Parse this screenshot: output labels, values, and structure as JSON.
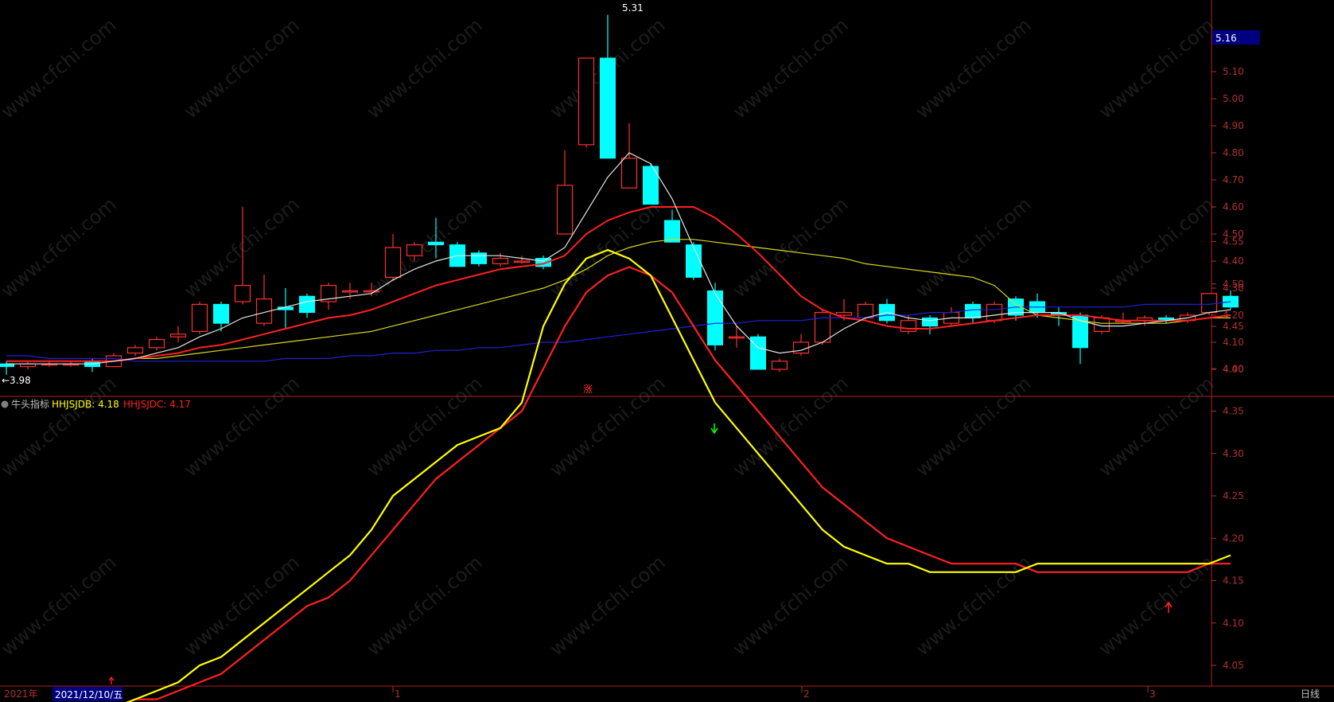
{
  "price_axis": {
    "ticks": [
      "5.10",
      "5.00",
      "4.90",
      "4.80",
      "4.70",
      "4.60",
      "4.50",
      "4.40",
      "4.30",
      "4.20",
      "4.10",
      "4.00"
    ],
    "current_price": "5.16"
  },
  "indicator_axis": {
    "ticks": [
      "4.55",
      "4.50",
      "4.45",
      "4.40",
      "4.35",
      "4.30",
      "4.25",
      "4.20",
      "4.15",
      "4.10",
      "4.05"
    ]
  },
  "annotations": {
    "high_label": "5.31",
    "low_label": "←3.98",
    "zhang": "涨"
  },
  "indicator_header": {
    "name": "牛头指标",
    "series_b_label": "HHJSJDB: 4.18",
    "series_c_label": "HHJSJDC: 4.17"
  },
  "time_axis": {
    "year_label": "2021年",
    "date_label": "2021/12/10/五",
    "month_labels": [
      "1",
      "2",
      "3"
    ],
    "period": "日线"
  },
  "watermark": "www.cfchi.com",
  "colors": {
    "up": "#ff3030",
    "down": "#00ffff",
    "ma_white": "#e6e6e6",
    "ma_red": "#ff2020",
    "ma_yellow": "#d8d820",
    "ma_blue": "#2020d8",
    "ind_yellow": "#ffff00",
    "ind_red": "#ff2020",
    "axis_red": "#b03030",
    "divider": "#b02020",
    "price_tag_bg": "#000080"
  },
  "chart_data": [
    {
      "type": "candlestick",
      "title": "",
      "ylim": [
        3.98,
        5.22
      ],
      "candles": [
        {
          "o": 4.02,
          "h": 4.03,
          "l": 3.98,
          "c": 4.01
        },
        {
          "o": 4.01,
          "h": 4.03,
          "l": 4.0,
          "c": 4.02
        },
        {
          "o": 4.02,
          "h": 4.03,
          "l": 4.01,
          "c": 4.02
        },
        {
          "o": 4.02,
          "h": 4.03,
          "l": 4.01,
          "c": 4.02
        },
        {
          "o": 4.03,
          "h": 4.04,
          "l": 3.99,
          "c": 4.01
        },
        {
          "o": 4.01,
          "h": 4.06,
          "l": 4.01,
          "c": 4.05
        },
        {
          "o": 4.06,
          "h": 4.09,
          "l": 4.05,
          "c": 4.08
        },
        {
          "o": 4.08,
          "h": 4.12,
          "l": 4.07,
          "c": 4.11
        },
        {
          "o": 4.12,
          "h": 4.16,
          "l": 4.1,
          "c": 4.13
        },
        {
          "o": 4.14,
          "h": 4.25,
          "l": 4.13,
          "c": 4.24
        },
        {
          "o": 4.24,
          "h": 4.25,
          "l": 4.14,
          "c": 4.17
        },
        {
          "o": 4.25,
          "h": 4.6,
          "l": 4.24,
          "c": 4.31
        },
        {
          "o": 4.17,
          "h": 4.35,
          "l": 4.16,
          "c": 4.26
        },
        {
          "o": 4.23,
          "h": 4.3,
          "l": 4.15,
          "c": 4.22
        },
        {
          "o": 4.27,
          "h": 4.28,
          "l": 4.19,
          "c": 4.21
        },
        {
          "o": 4.25,
          "h": 4.32,
          "l": 4.22,
          "c": 4.31
        },
        {
          "o": 4.29,
          "h": 4.32,
          "l": 4.26,
          "c": 4.29
        },
        {
          "o": 4.29,
          "h": 4.32,
          "l": 4.27,
          "c": 4.29
        },
        {
          "o": 4.34,
          "h": 4.5,
          "l": 4.33,
          "c": 4.45
        },
        {
          "o": 4.42,
          "h": 4.47,
          "l": 4.4,
          "c": 4.46
        },
        {
          "o": 4.47,
          "h": 4.56,
          "l": 4.41,
          "c": 4.46
        },
        {
          "o": 4.46,
          "h": 4.47,
          "l": 4.38,
          "c": 4.38
        },
        {
          "o": 4.43,
          "h": 4.44,
          "l": 4.38,
          "c": 4.39
        },
        {
          "o": 4.39,
          "h": 4.43,
          "l": 4.38,
          "c": 4.41
        },
        {
          "o": 4.4,
          "h": 4.42,
          "l": 4.39,
          "c": 4.4
        },
        {
          "o": 4.41,
          "h": 4.42,
          "l": 4.37,
          "c": 4.38
        },
        {
          "o": 4.5,
          "h": 4.81,
          "l": 4.5,
          "c": 4.68
        },
        {
          "o": 4.83,
          "h": 5.15,
          "l": 4.82,
          "c": 5.15
        },
        {
          "o": 5.15,
          "h": 5.31,
          "l": 4.78,
          "c": 4.78
        },
        {
          "o": 4.67,
          "h": 4.91,
          "l": 4.67,
          "c": 4.78
        },
        {
          "o": 4.75,
          "h": 4.76,
          "l": 4.61,
          "c": 4.61
        },
        {
          "o": 4.55,
          "h": 4.59,
          "l": 4.47,
          "c": 4.47
        },
        {
          "o": 4.46,
          "h": 4.47,
          "l": 4.33,
          "c": 4.34
        },
        {
          "o": 4.29,
          "h": 4.32,
          "l": 4.07,
          "c": 4.09
        },
        {
          "o": 4.12,
          "h": 4.16,
          "l": 4.08,
          "c": 4.12
        },
        {
          "o": 4.12,
          "h": 4.13,
          "l": 4.0,
          "c": 4.0
        },
        {
          "o": 4.0,
          "h": 4.04,
          "l": 3.99,
          "c": 4.03
        },
        {
          "o": 4.06,
          "h": 4.13,
          "l": 4.05,
          "c": 4.1
        },
        {
          "o": 4.1,
          "h": 4.22,
          "l": 4.09,
          "c": 4.21
        },
        {
          "o": 4.2,
          "h": 4.26,
          "l": 4.18,
          "c": 4.21
        },
        {
          "o": 4.19,
          "h": 4.25,
          "l": 4.18,
          "c": 4.24
        },
        {
          "o": 4.24,
          "h": 4.26,
          "l": 4.17,
          "c": 4.18
        },
        {
          "o": 4.14,
          "h": 4.2,
          "l": 4.13,
          "c": 4.18
        },
        {
          "o": 4.19,
          "h": 4.2,
          "l": 4.13,
          "c": 4.16
        },
        {
          "o": 4.17,
          "h": 4.23,
          "l": 4.16,
          "c": 4.21
        },
        {
          "o": 4.24,
          "h": 4.25,
          "l": 4.17,
          "c": 4.19
        },
        {
          "o": 4.18,
          "h": 4.25,
          "l": 4.17,
          "c": 4.24
        },
        {
          "o": 4.26,
          "h": 4.27,
          "l": 4.18,
          "c": 4.2
        },
        {
          "o": 4.25,
          "h": 4.28,
          "l": 4.19,
          "c": 4.21
        },
        {
          "o": 4.21,
          "h": 4.23,
          "l": 4.16,
          "c": 4.2
        },
        {
          "o": 4.2,
          "h": 4.21,
          "l": 4.02,
          "c": 4.08
        },
        {
          "o": 4.14,
          "h": 4.2,
          "l": 4.13,
          "c": 4.19
        },
        {
          "o": 4.18,
          "h": 4.21,
          "l": 4.17,
          "c": 4.18
        },
        {
          "o": 4.18,
          "h": 4.2,
          "l": 4.16,
          "c": 4.19
        },
        {
          "o": 4.19,
          "h": 4.2,
          "l": 4.17,
          "c": 4.18
        },
        {
          "o": 4.18,
          "h": 4.21,
          "l": 4.17,
          "c": 4.2
        },
        {
          "o": 4.21,
          "h": 4.28,
          "l": 4.2,
          "c": 4.28
        },
        {
          "o": 4.27,
          "h": 4.29,
          "l": 4.22,
          "c": 4.23
        }
      ],
      "ma_white": [
        4.02,
        4.02,
        4.02,
        4.02,
        4.02,
        4.03,
        4.04,
        4.06,
        4.08,
        4.12,
        4.15,
        4.19,
        4.21,
        4.23,
        4.25,
        4.26,
        4.27,
        4.28,
        4.33,
        4.37,
        4.4,
        4.42,
        4.42,
        4.42,
        4.41,
        4.4,
        4.45,
        4.58,
        4.71,
        4.8,
        4.76,
        4.63,
        4.45,
        4.28,
        4.16,
        4.08,
        4.06,
        4.07,
        4.1,
        4.15,
        4.19,
        4.21,
        4.19,
        4.18,
        4.19,
        4.19,
        4.2,
        4.21,
        4.21,
        4.21,
        4.18,
        4.16,
        4.16,
        4.17,
        4.18,
        4.19,
        4.21,
        4.22
      ],
      "ma_red": [
        4.03,
        4.03,
        4.03,
        4.03,
        4.03,
        4.03,
        4.04,
        4.05,
        4.06,
        4.08,
        4.09,
        4.11,
        4.13,
        4.15,
        4.17,
        4.19,
        4.2,
        4.22,
        4.25,
        4.28,
        4.31,
        4.33,
        4.35,
        4.37,
        4.38,
        4.39,
        4.42,
        4.5,
        4.55,
        4.58,
        4.6,
        4.6,
        4.6,
        4.56,
        4.5,
        4.43,
        4.35,
        4.27,
        4.22,
        4.19,
        4.18,
        4.16,
        4.15,
        4.15,
        4.16,
        4.17,
        4.18,
        4.19,
        4.2,
        4.2,
        4.2,
        4.19,
        4.18,
        4.18,
        4.18,
        4.18,
        4.19,
        4.2
      ],
      "ma_yellow": [
        4.03,
        4.03,
        4.03,
        4.03,
        4.03,
        4.03,
        4.04,
        4.04,
        4.05,
        4.06,
        4.07,
        4.08,
        4.09,
        4.1,
        4.11,
        4.12,
        4.13,
        4.14,
        4.16,
        4.18,
        4.2,
        4.22,
        4.24,
        4.26,
        4.28,
        4.3,
        4.33,
        4.37,
        4.42,
        4.45,
        4.47,
        4.48,
        4.48,
        4.47,
        4.46,
        4.45,
        4.44,
        4.43,
        4.42,
        4.41,
        4.39,
        4.38,
        4.37,
        4.36,
        4.35,
        4.34,
        4.31,
        4.24,
        4.2,
        4.19,
        4.18,
        4.17,
        4.17,
        4.17,
        4.17,
        4.18,
        4.19,
        4.19
      ],
      "ma_blue": [
        4.05,
        4.05,
        4.04,
        4.04,
        4.04,
        4.04,
        4.03,
        4.03,
        4.03,
        4.03,
        4.03,
        4.03,
        4.03,
        4.04,
        4.04,
        4.04,
        4.05,
        4.05,
        4.06,
        4.06,
        4.07,
        4.07,
        4.08,
        4.08,
        4.09,
        4.1,
        4.1,
        4.11,
        4.12,
        4.13,
        4.14,
        4.15,
        4.16,
        4.17,
        4.17,
        4.18,
        4.18,
        4.18,
        4.19,
        4.19,
        4.19,
        4.2,
        4.2,
        4.21,
        4.21,
        4.22,
        4.22,
        4.23,
        4.23,
        4.23,
        4.23,
        4.23,
        4.23,
        4.24,
        4.24,
        4.24,
        4.24,
        4.25
      ]
    },
    {
      "type": "line",
      "title": "",
      "ylim": [
        4.0,
        4.57
      ],
      "x": [
        0,
        1,
        2,
        3,
        4,
        5,
        6,
        7,
        8,
        9,
        10,
        11,
        12,
        13,
        14,
        15,
        16,
        17,
        18,
        19,
        20,
        21,
        22,
        23,
        24,
        25,
        26,
        27,
        28,
        29,
        30,
        31,
        32,
        33,
        34,
        35,
        36,
        37,
        38,
        39,
        40,
        41,
        42,
        43,
        44,
        45,
        46,
        47,
        48,
        49,
        50,
        51,
        52,
        53,
        54,
        55,
        56,
        57
      ],
      "series": [
        {
          "name": "HHJSJDB",
          "values": [
            4.0,
            4.0,
            4.0,
            4.0,
            4.0,
            4.0,
            4.01,
            4.02,
            4.03,
            4.05,
            4.06,
            4.08,
            4.1,
            4.12,
            4.14,
            4.16,
            4.18,
            4.21,
            4.25,
            4.27,
            4.29,
            4.31,
            4.32,
            4.33,
            4.36,
            4.45,
            4.5,
            4.53,
            4.54,
            4.53,
            4.51,
            4.46,
            4.41,
            4.36,
            4.33,
            4.3,
            4.27,
            4.24,
            4.21,
            4.19,
            4.18,
            4.17,
            4.17,
            4.16,
            4.16,
            4.16,
            4.16,
            4.16,
            4.17,
            4.17,
            4.17,
            4.17,
            4.17,
            4.17,
            4.17,
            4.17,
            4.17,
            4.18
          ]
        },
        {
          "name": "HHJSJDC",
          "values": [
            4.0,
            4.0,
            4.0,
            4.0,
            4.0,
            4.0,
            4.01,
            4.01,
            4.02,
            4.03,
            4.04,
            4.06,
            4.08,
            4.1,
            4.12,
            4.13,
            4.15,
            4.18,
            4.21,
            4.24,
            4.27,
            4.29,
            4.31,
            4.33,
            4.35,
            4.4,
            4.45,
            4.49,
            4.51,
            4.52,
            4.51,
            4.49,
            4.45,
            4.41,
            4.38,
            4.35,
            4.32,
            4.29,
            4.26,
            4.24,
            4.22,
            4.2,
            4.19,
            4.18,
            4.17,
            4.17,
            4.17,
            4.17,
            4.16,
            4.16,
            4.16,
            4.16,
            4.16,
            4.16,
            4.16,
            4.16,
            4.17,
            4.17
          ]
        }
      ]
    }
  ]
}
